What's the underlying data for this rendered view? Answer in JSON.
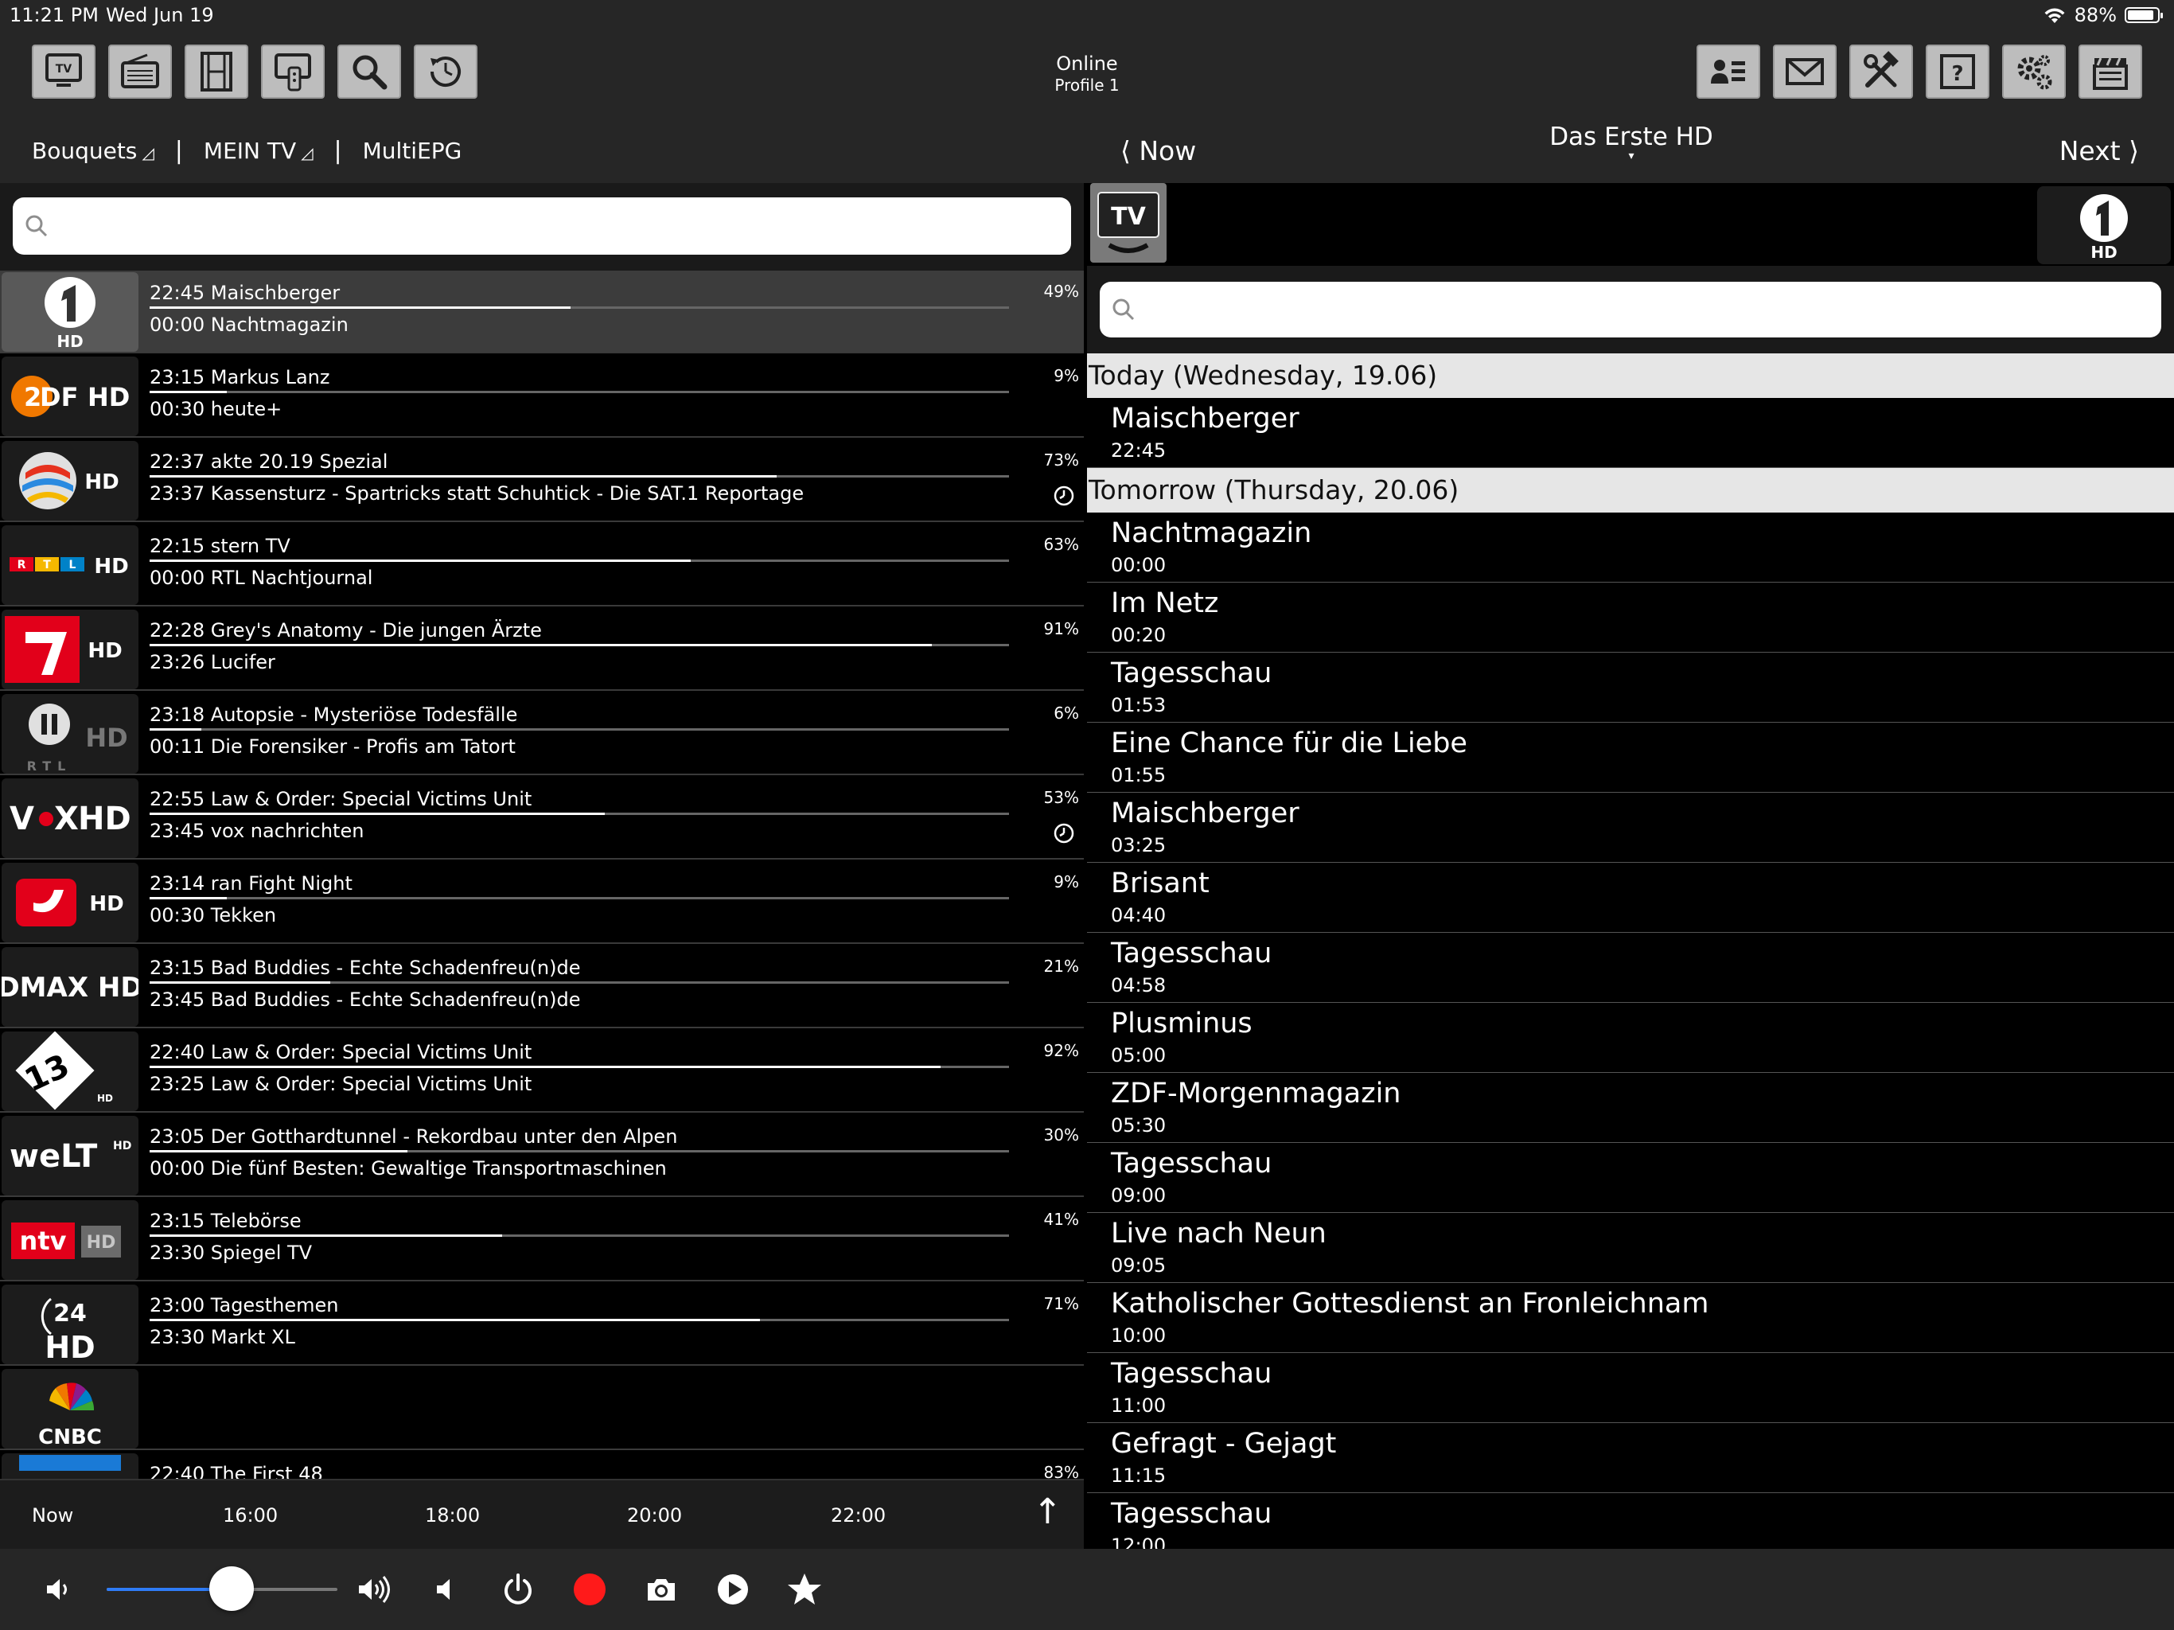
{
  "status": {
    "time": "11:21 PM",
    "date": "Wed Jun 19",
    "battery": "88%",
    "battery_level": 0.88
  },
  "toolbar": {
    "online": "Online",
    "profile": "Profile 1",
    "left_buttons": [
      "tv-icon",
      "radio-icon",
      "film-icon",
      "remote-icon",
      "search-icon",
      "history-icon"
    ],
    "right_buttons": [
      "contacts-icon",
      "mail-icon",
      "tools-icon",
      "help-icon",
      "settings-icon",
      "clapper-icon"
    ]
  },
  "nav": {
    "bouquets": "Bouquets",
    "mein_tv": "MEIN TV",
    "multiepg": "MultiEPG",
    "now": "Now",
    "next": "Next",
    "channel": "Das Erste HD"
  },
  "channels": [
    {
      "logo": "Das Erste HD",
      "now": "22:45 Maischberger",
      "next": "00:00 Nachtmagazin",
      "percent": "49%",
      "progress": 0.49,
      "timer": false,
      "selected": true
    },
    {
      "logo": "ZDF HD",
      "now": "23:15 Markus Lanz",
      "next": "00:30 heute+",
      "percent": "9%",
      "progress": 0.09,
      "timer": false
    },
    {
      "logo": "SAT.1 HD",
      "now": "22:37 akte 20.19 Spezial",
      "next": "23:37 Kassensturz - Spartricks statt Schuhtick - Die SAT.1 Reportage",
      "percent": "73%",
      "progress": 0.73,
      "timer": true
    },
    {
      "logo": "RTL HD",
      "now": "22:15 stern TV",
      "next": "00:00 RTL Nachtjournal",
      "percent": "63%",
      "progress": 0.63,
      "timer": false
    },
    {
      "logo": "ProSieben HD",
      "now": "22:28 Grey's Anatomy - Die jungen Ärzte",
      "next": "23:26 Lucifer",
      "percent": "91%",
      "progress": 0.91,
      "timer": false
    },
    {
      "logo": "RTL II HD",
      "now": "23:18 Autopsie - Mysteriöse Todesfälle",
      "next": "00:11 Die Forensiker - Profis am Tatort",
      "percent": "6%",
      "progress": 0.06,
      "timer": false
    },
    {
      "logo": "VOX HD",
      "now": "22:55 Law & Order: Special Victims Unit",
      "next": "23:45 vox nachrichten",
      "percent": "53%",
      "progress": 0.53,
      "timer": true
    },
    {
      "logo": "kabel eins HD",
      "now": "23:14 ran Fight Night",
      "next": "00:30 Tekken",
      "percent": "9%",
      "progress": 0.09,
      "timer": false
    },
    {
      "logo": "DMAX HD",
      "now": "23:15 Bad Buddies - Echte Schadenfreu(n)de",
      "next": "23:45 Bad Buddies - Echte Schadenfreu(n)de",
      "percent": "21%",
      "progress": 0.21,
      "timer": false
    },
    {
      "logo": "13th Street HD",
      "now": "22:40 Law & Order: Special Victims Unit",
      "next": "23:25 Law & Order: Special Victims Unit",
      "percent": "92%",
      "progress": 0.92,
      "timer": false
    },
    {
      "logo": "WELT HD",
      "now": "23:05 Der Gotthardtunnel - Rekordbau unter den Alpen",
      "next": "00:00 Die fünf Besten: Gewaltige Transportmaschinen",
      "percent": "30%",
      "progress": 0.3,
      "timer": false
    },
    {
      "logo": "n-tv HD",
      "now": "23:15 Telebörse",
      "next": "23:30 Spiegel TV",
      "percent": "41%",
      "progress": 0.41,
      "timer": false
    },
    {
      "logo": "24 HD",
      "now": "23:00 Tagesthemen",
      "next": "23:30 Markt XL",
      "percent": "71%",
      "progress": 0.71,
      "timer": false
    },
    {
      "logo": "CNBC",
      "now": "",
      "next": "",
      "percent": "",
      "progress": null,
      "timer": false
    },
    {
      "logo": "",
      "now": "22:40 The First 48",
      "next": "",
      "percent": "83%",
      "progress": 0.83,
      "timer": false
    }
  ],
  "timeline": [
    "Now",
    "16:00",
    "18:00",
    "20:00",
    "22:00"
  ],
  "epg": {
    "sections": [
      {
        "day": "Today (Wednesday, 19.06)",
        "items": [
          {
            "title": "Maischberger",
            "time": "22:45"
          }
        ]
      },
      {
        "day": "Tomorrow (Thursday, 20.06)",
        "items": [
          {
            "title": "Nachtmagazin",
            "time": "00:00"
          },
          {
            "title": "Im Netz",
            "time": "00:20"
          },
          {
            "title": "Tagesschau",
            "time": "01:53"
          },
          {
            "title": "Eine Chance für die Liebe",
            "time": "01:55"
          },
          {
            "title": "Maischberger",
            "time": "03:25"
          },
          {
            "title": "Brisant",
            "time": "04:40"
          },
          {
            "title": "Tagesschau",
            "time": "04:58"
          },
          {
            "title": "Plusminus",
            "time": "05:00"
          },
          {
            "title": "ZDF-Morgenmagazin",
            "time": "05:30"
          },
          {
            "title": "Tagesschau",
            "time": "09:00"
          },
          {
            "title": "Live nach Neun",
            "time": "09:05"
          },
          {
            "title": "Katholischer Gottesdienst an Fronleichnam",
            "time": "10:00"
          },
          {
            "title": "Tagesschau",
            "time": "11:00"
          },
          {
            "title": "Gefragt - Gejagt",
            "time": "11:15"
          },
          {
            "title": "Tagesschau",
            "time": "12:00"
          }
        ]
      }
    ]
  },
  "bottom": {
    "volume": 0.54,
    "accent": "#2f7cf6",
    "record_color": "#ff1a1a"
  },
  "header_logos": {
    "tv": "TV",
    "hd": "HD"
  }
}
